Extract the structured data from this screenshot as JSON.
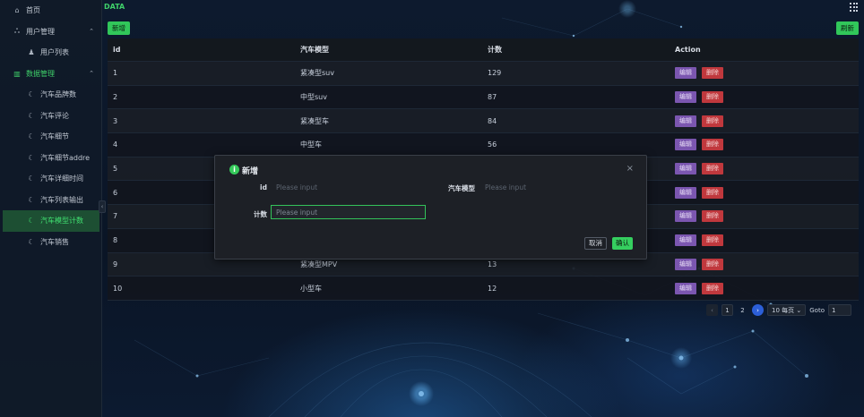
{
  "topbar": {
    "title": "DATA"
  },
  "sidebar": {
    "items": [
      {
        "label": "首页",
        "icon": "home-icon"
      },
      {
        "label": "用户管理",
        "icon": "users-icon"
      },
      {
        "label": "用户列表",
        "icon": "user-list-icon"
      },
      {
        "label": "数据管理",
        "icon": "bar-chart-icon"
      },
      {
        "label": "汽车品牌数",
        "icon": "moon-icon"
      },
      {
        "label": "汽车评论",
        "icon": "moon-icon"
      },
      {
        "label": "汽车细节",
        "icon": "moon-icon"
      },
      {
        "label": "汽车细节addre",
        "icon": "moon-icon"
      },
      {
        "label": "汽车详细时间",
        "icon": "moon-icon"
      },
      {
        "label": "汽车列表输出",
        "icon": "moon-icon"
      },
      {
        "label": "汽车模型计数",
        "icon": "moon-icon"
      },
      {
        "label": "汽车销售",
        "icon": "moon-icon"
      }
    ]
  },
  "toolbar": {
    "add_label": "新增",
    "refresh_label": "刷新"
  },
  "table": {
    "headers": [
      "id",
      "汽车模型",
      "计数",
      "Action"
    ],
    "edit_label": "编辑",
    "delete_label": "删除",
    "rows": [
      {
        "id": "1",
        "model": "紧凑型suv",
        "count": "129"
      },
      {
        "id": "2",
        "model": "中型suv",
        "count": "87"
      },
      {
        "id": "3",
        "model": "紧凑型车",
        "count": "84"
      },
      {
        "id": "4",
        "model": "中型车",
        "count": "56"
      },
      {
        "id": "5",
        "model": "",
        "count": ""
      },
      {
        "id": "6",
        "model": "",
        "count": ""
      },
      {
        "id": "7",
        "model": "",
        "count": ""
      },
      {
        "id": "8",
        "model": "",
        "count": ""
      },
      {
        "id": "9",
        "model": "紧凑型MPV",
        "count": "13"
      },
      {
        "id": "10",
        "model": "小型车",
        "count": "12"
      }
    ]
  },
  "pagination": {
    "prev": "‹",
    "page1": "1",
    "page2": "2",
    "next": "›",
    "page_size": "10 每页",
    "goto_label": "Goto",
    "goto_value": "1"
  },
  "modal": {
    "title": "新增",
    "close": "×",
    "id_label": "id",
    "id_placeholder": "Please input",
    "model_label": "汽车模型",
    "model_placeholder": "Please input",
    "count_label": "计数",
    "count_placeholder": "Please input",
    "cancel_label": "取消",
    "ok_label": "确认"
  },
  "colors": {
    "accent_green": "#35c95a",
    "edit_purple": "#7b56b0",
    "delete_red": "#c0383d",
    "page_active_blue": "#2c5fd8"
  }
}
